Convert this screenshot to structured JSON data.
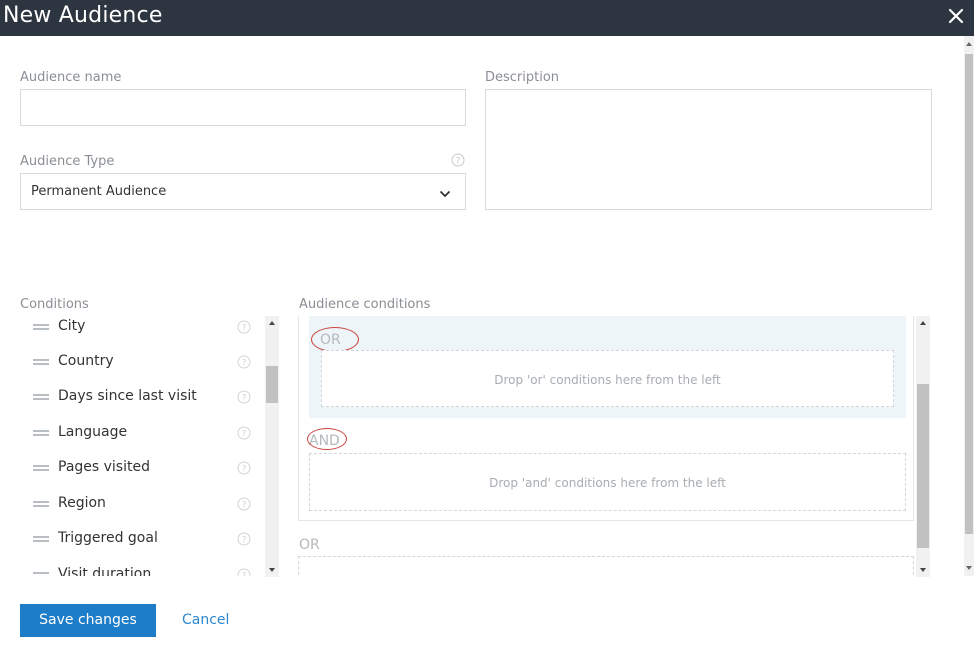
{
  "dialog": {
    "title": "New Audience"
  },
  "form": {
    "audience_name": {
      "label": "Audience name",
      "value": "",
      "placeholder": ""
    },
    "description": {
      "label": "Description",
      "value": ""
    },
    "audience_type": {
      "label": "Audience Type",
      "value": "Permanent Audience"
    }
  },
  "conditions": {
    "label": "Conditions",
    "items": [
      {
        "label": "City"
      },
      {
        "label": "Country"
      },
      {
        "label": "Days since last visit"
      },
      {
        "label": "Language"
      },
      {
        "label": "Pages visited"
      },
      {
        "label": "Region"
      },
      {
        "label": "Triggered goal"
      },
      {
        "label": "Visit duration"
      }
    ]
  },
  "audience_conditions": {
    "label": "Audience conditions",
    "or_label": "OR",
    "or_drop_text": "Drop 'or' conditions here from the left",
    "and_label": "AND",
    "and_drop_text": "Drop 'and' conditions here from the left",
    "next_or_label": "OR"
  },
  "footer": {
    "save_label": "Save changes",
    "cancel_label": "Cancel"
  },
  "colors": {
    "titlebar": "#2d3540",
    "accent": "#1e7dc8",
    "highlight_circle": "#c9443c"
  },
  "icons": {
    "close": "close-icon",
    "help": "help-circle-icon",
    "chevron": "chevron-down-icon",
    "drag": "drag-handle-icon"
  }
}
